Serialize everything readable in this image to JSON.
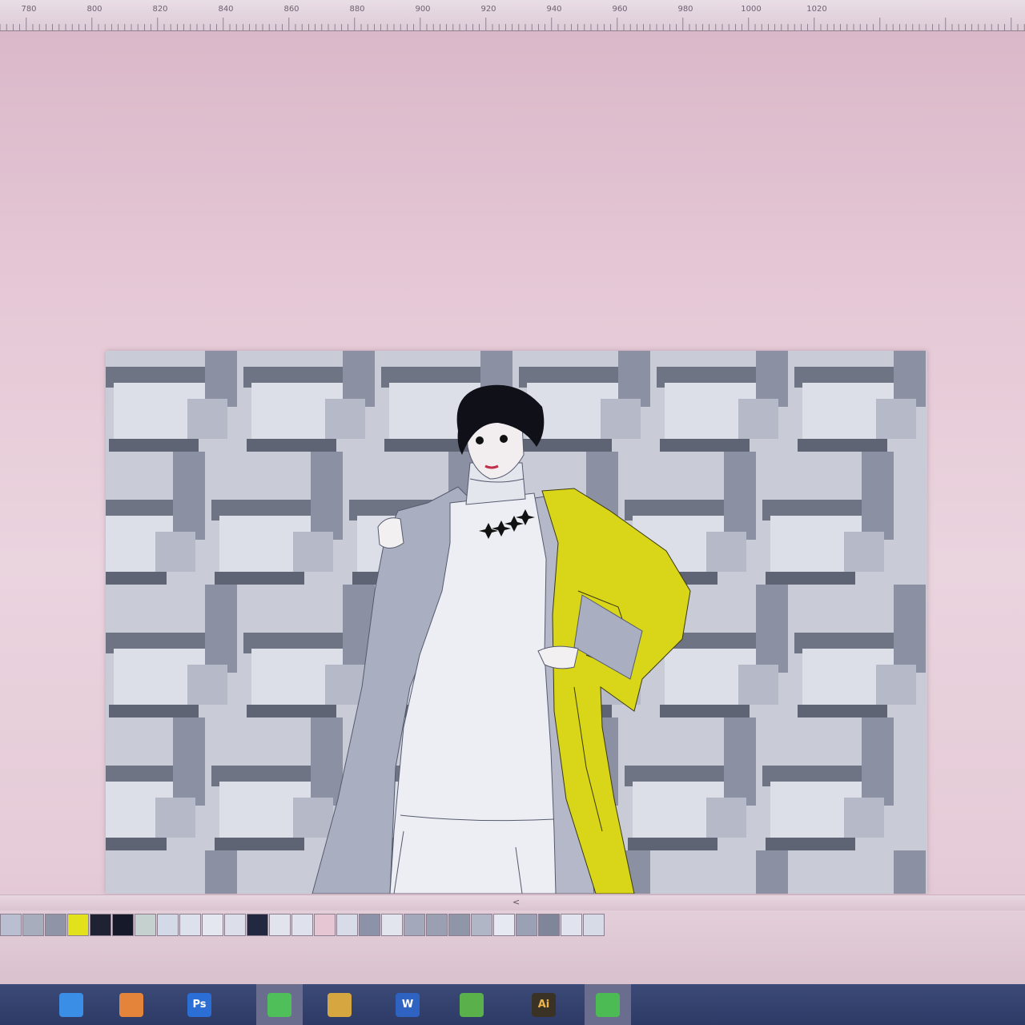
{
  "ruler": {
    "labels": [
      "780",
      "800",
      "820",
      "840",
      "860",
      "880",
      "900",
      "920",
      "940",
      "960",
      "980",
      "1000",
      "1020"
    ]
  },
  "scrollbar": {
    "thumb_glyph": "<"
  },
  "palette": {
    "swatches": [
      "#b9bfd0",
      "#a7adbd",
      "#8f95a6",
      "#e2e21c",
      "#1e2233",
      "#15192a",
      "#c4d1cf",
      "#d3d9e6",
      "#dde1ec",
      "#e4e7f0",
      "#dcdfe9",
      "#222840",
      "#e1e4ed",
      "#dfe2ec",
      "#e7c6d3",
      "#d8dce8",
      "#8c93a8",
      "#e2e5ee",
      "#a3a9ba",
      "#9aa0b2",
      "#8f96a8",
      "#b0b6c6",
      "#e6e9f1",
      "#9aa1b5",
      "#7f869a",
      "#e1e4ee",
      "#d7dbe7"
    ]
  },
  "taskbar": {
    "apps": [
      {
        "name": "browser-icon",
        "label": "",
        "color": "#3a8ee6",
        "active": false
      },
      {
        "name": "gift-icon",
        "label": "",
        "color": "#e3843a",
        "active": false
      },
      {
        "name": "photoshop-icon",
        "label": "Ps",
        "color": "#2b6fd6",
        "active": false
      },
      {
        "name": "chat-app-icon",
        "label": "",
        "color": "#4fbf5a",
        "active": true
      },
      {
        "name": "folder-icon",
        "label": "",
        "color": "#d6a740",
        "active": false
      },
      {
        "name": "word-icon",
        "label": "W",
        "color": "#2f63c2",
        "active": false
      },
      {
        "name": "globe-icon",
        "label": "",
        "color": "#5ab04a",
        "active": false
      },
      {
        "name": "illustrator-icon",
        "label": "Ai",
        "color": "#3b3226",
        "active": false
      },
      {
        "name": "wechat-icon",
        "label": "",
        "color": "#4cbb53",
        "active": true
      }
    ]
  },
  "colors": {
    "coat_yellow": "#d9d619",
    "coat_grey": "#a9aec0",
    "dress_white": "#eceef4",
    "hair": "#101018"
  }
}
